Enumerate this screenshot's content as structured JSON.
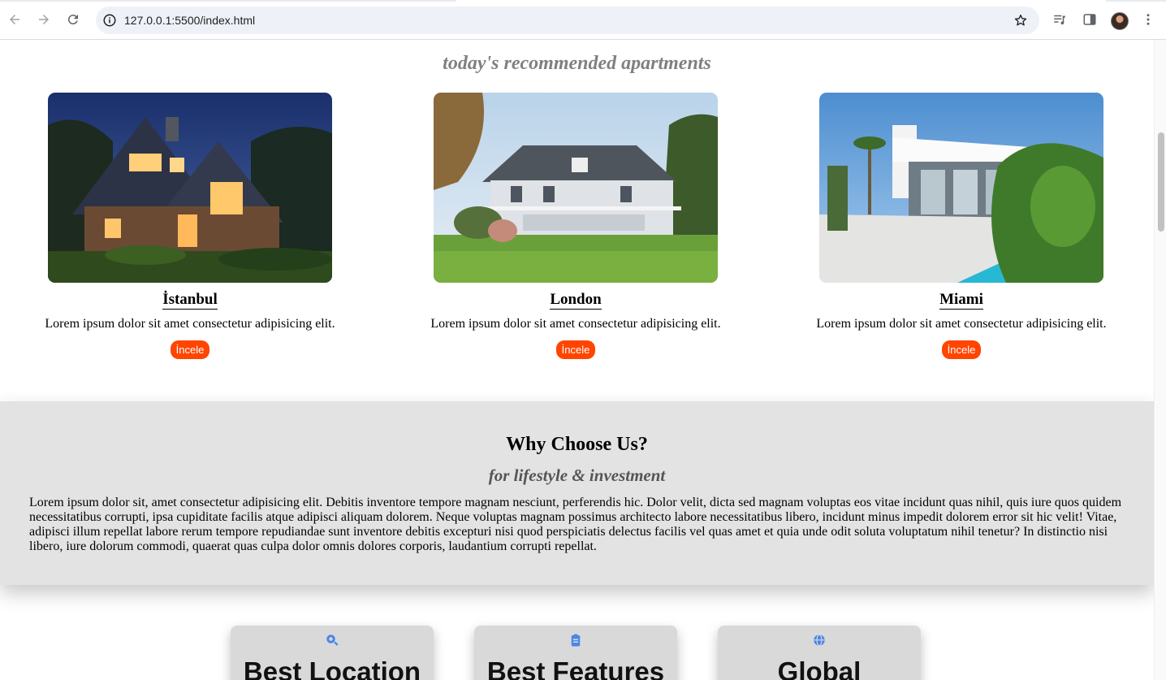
{
  "browser": {
    "url": "127.0.0.1:5500/index.html"
  },
  "recommended": {
    "title": "today's recommended apartments",
    "cards": [
      {
        "city": "İstanbul",
        "description": "Lorem ipsum dolor sit amet consectetur adipisicing elit.",
        "button": "İncele"
      },
      {
        "city": "London",
        "description": "Lorem ipsum dolor sit amet consectetur adipisicing elit.",
        "button": "İncele"
      },
      {
        "city": "Miami",
        "description": "Lorem ipsum dolor sit amet consectetur adipisicing elit.",
        "button": "İncele"
      }
    ]
  },
  "why": {
    "title": "Why Choose Us?",
    "subtitle": "for lifestyle & investment",
    "text": "Lorem ipsum dolor sit, amet consectetur adipisicing elit. Debitis inventore tempore magnam nesciunt, perferendis hic. Dolor velit, dicta sed magnam voluptas eos vitae incidunt quas nihil, quis iure quos quidem necessitatibus corrupti, ipsa cupiditate facilis atque adipisci aliquam dolorem. Neque voluptas magnam possimus architecto labore necessitatibus libero, incidunt minus impedit dolorem error sit hic velit! Vitae, adipisci illum repellat labore rerum tempore repudiandae sunt inventore debitis excepturi nisi quod perspiciatis delectus facilis vel quas amet et quia unde odit soluta voluptatum nihil tenetur? In distinctio nisi libero, iure dolorum commodi, quaerat quas culpa dolor omnis dolores corporis, laudantium corrupti repellat."
  },
  "features": [
    {
      "title": "Best Location",
      "icon": "magnifier-icon"
    },
    {
      "title": "Best Features",
      "icon": "clipboard-icon"
    },
    {
      "title": "Global",
      "icon": "globe-icon"
    }
  ],
  "colors": {
    "accent_button": "#ff4500",
    "section_bg": "#e3e3e3",
    "feature_icon": "#4a86e8"
  }
}
